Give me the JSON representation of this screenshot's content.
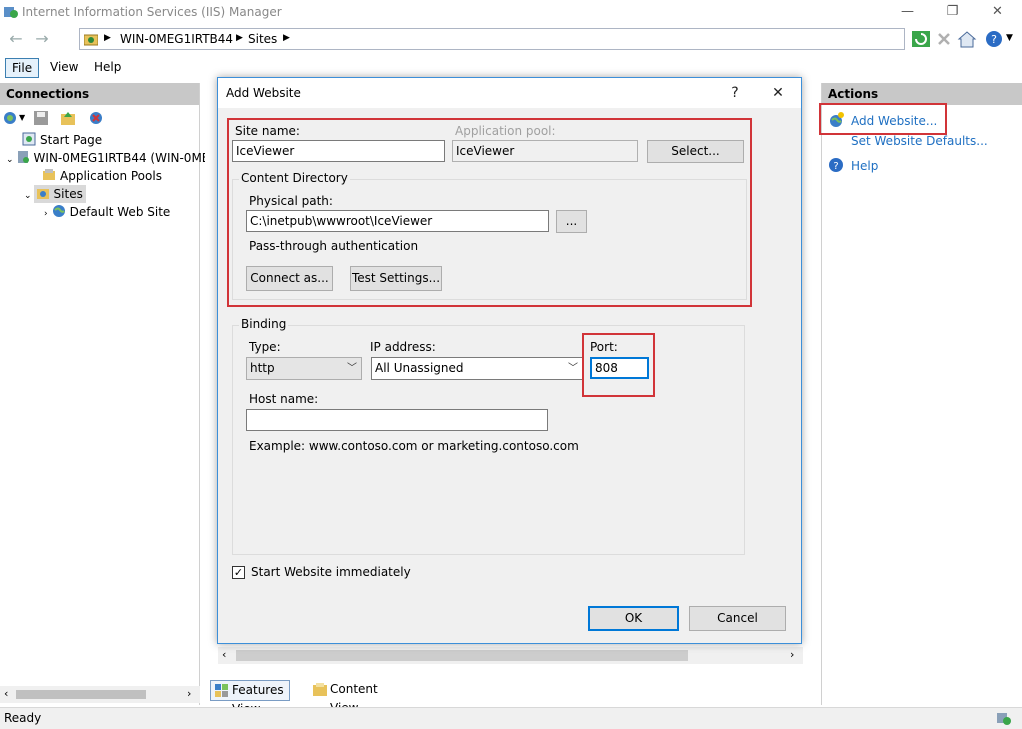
{
  "window": {
    "title": "Internet Information Services (IIS) Manager"
  },
  "address": {
    "segments": [
      "WIN-0MEG1IRTB44",
      "Sites"
    ]
  },
  "menu": {
    "items": [
      "File",
      "View",
      "Help"
    ]
  },
  "connections": {
    "header": "Connections",
    "tree": [
      {
        "label": "Start Page",
        "level": 0
      },
      {
        "label": "WIN-0MEG1IRTB44 (WIN-0ME",
        "level": 0
      },
      {
        "label": "Application Pools",
        "level": 1
      },
      {
        "label": "Sites",
        "level": 1
      },
      {
        "label": "Default Web Site",
        "level": 2
      }
    ]
  },
  "view_tabs": {
    "features": "Features View",
    "content": "Content View"
  },
  "actions": {
    "header": "Actions",
    "add_website": "Add Website...",
    "set_defaults": "Set Website Defaults...",
    "help": "Help"
  },
  "status": {
    "text": "Ready"
  },
  "dialog": {
    "title": "Add Website",
    "help_glyph": "?",
    "close_glyph": "✕",
    "site_name_label": "Site name:",
    "site_name_value": "IceViewer",
    "app_pool_label": "Application pool:",
    "app_pool_value": "IceViewer",
    "select_button": "Select...",
    "content_dir_title": "Content Directory",
    "physical_path_label": "Physical path:",
    "physical_path_value": "C:\\inetpub\\wwwroot\\IceViewer",
    "browse_button": "...",
    "passthrough_label": "Pass-through authentication",
    "connect_as_button": "Connect as...",
    "test_settings_button": "Test Settings...",
    "binding_title": "Binding",
    "type_label": "Type:",
    "type_value": "http",
    "ip_label": "IP address:",
    "ip_value": "All Unassigned",
    "port_label": "Port:",
    "port_value": "808",
    "host_label": "Host name:",
    "host_value": "",
    "example_text": "Example: www.contoso.com or marketing.contoso.com",
    "start_immediately_label": "Start Website immediately",
    "start_immediately_checked": true,
    "ok_button": "OK",
    "cancel_button": "Cancel"
  },
  "colors": {
    "accent": "#0078d7",
    "highlight": "#d13438",
    "link": "#1e6fc2"
  }
}
